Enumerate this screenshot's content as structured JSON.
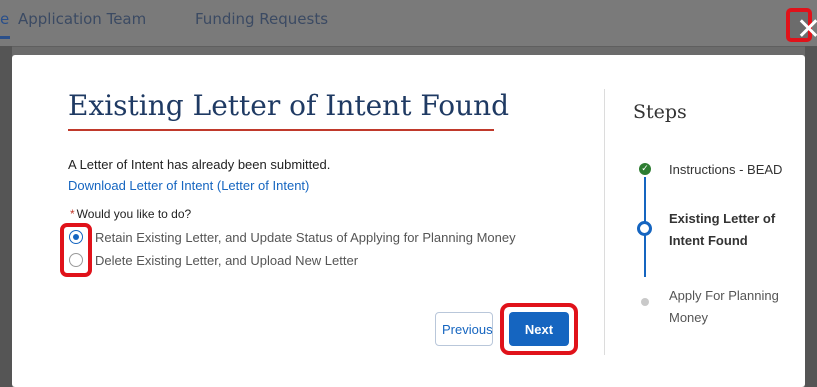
{
  "background_nav": {
    "tabs": [
      "e",
      "Application Team",
      "Funding Requests"
    ]
  },
  "close_label": "✕",
  "modal": {
    "title": "Existing Letter of Intent Found",
    "info_text": "A Letter of Intent has already been submitted.",
    "download_link": "Download Letter of Intent (Letter of Intent)",
    "question": {
      "required_marker": "*",
      "label": "Would you like to do?"
    },
    "options": [
      {
        "label": "Retain Existing Letter, and Update Status of Applying for Planning Money",
        "selected": true
      },
      {
        "label": "Delete Existing Letter, and Upload New Letter",
        "selected": false
      }
    ],
    "previous_label": "Previous",
    "next_label": "Next"
  },
  "steps": {
    "title": "Steps",
    "items": [
      {
        "label": "Instructions - BEAD",
        "status": "complete"
      },
      {
        "label": "Existing Letter of Intent Found",
        "status": "current"
      },
      {
        "label": "Apply For Planning Money",
        "status": "upcoming"
      }
    ]
  },
  "colors": {
    "accent_blue": "#1565c0",
    "title_blue": "#1f3a63",
    "title_rule": "#c0392b",
    "highlight_red": "#e0121a",
    "complete_green": "#2e7d32"
  }
}
